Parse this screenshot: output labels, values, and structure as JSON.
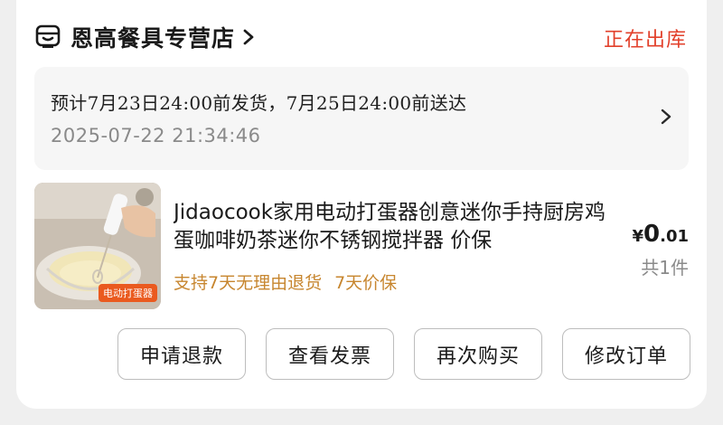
{
  "store": {
    "name": "恩高餐具专营店",
    "status": "正在出库"
  },
  "shipping": {
    "estimate": "预计7月23日24:00前发货，7月25日24:00前送达",
    "timestamp": "2025-07-22 21:34:46"
  },
  "product": {
    "title": "Jidaocook家用电动打蛋器创意迷你手持厨房鸡蛋咖啡奶茶迷你不锈钢搅拌器 价保",
    "image_label": "电动打蛋器",
    "tags": [
      "支持7天无理由退货",
      "7天价保"
    ],
    "price": {
      "currency": "¥",
      "integer": "0",
      "decimal": ".01"
    },
    "quantity": "共1件"
  },
  "actions": {
    "refund": "申请退款",
    "invoice": "查看发票",
    "rebuy": "再次购买",
    "modify": "修改订单"
  },
  "colors": {
    "status": "#e2402b",
    "tag": "#c7862f",
    "thumb_label_bg": "#ea5a1f"
  }
}
